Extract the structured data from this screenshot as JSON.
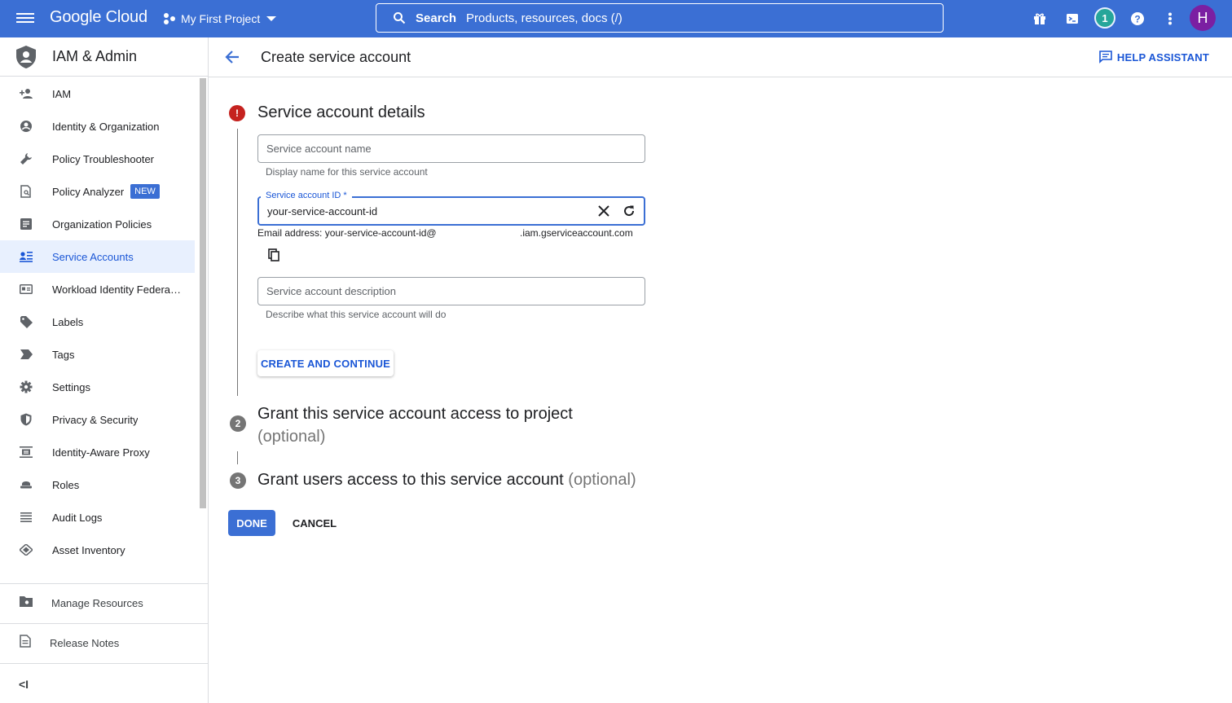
{
  "topbar": {
    "brand": "Google Cloud",
    "project": "My First Project",
    "search_label": "Search",
    "search_placeholder": "Products, resources, docs (/)",
    "notifications": "1",
    "avatar_initial": "H"
  },
  "sidebar": {
    "title": "IAM & Admin",
    "items": [
      {
        "label": "IAM",
        "icon": "person-add-icon"
      },
      {
        "label": "Identity & Organization",
        "icon": "account-circle-icon"
      },
      {
        "label": "Policy Troubleshooter",
        "icon": "wrench-icon"
      },
      {
        "label": "Policy Analyzer",
        "icon": "document-search-icon",
        "badge": "NEW"
      },
      {
        "label": "Organization Policies",
        "icon": "list-document-icon"
      },
      {
        "label": "Service Accounts",
        "icon": "service-account-icon",
        "active": true
      },
      {
        "label": "Workload Identity Federat…",
        "icon": "id-card-icon"
      },
      {
        "label": "Labels",
        "icon": "label-icon"
      },
      {
        "label": "Tags",
        "icon": "tag-icon"
      },
      {
        "label": "Settings",
        "icon": "gear-icon"
      },
      {
        "label": "Privacy & Security",
        "icon": "shield-icon"
      },
      {
        "label": "Identity-Aware Proxy",
        "icon": "proxy-icon"
      },
      {
        "label": "Roles",
        "icon": "roles-icon"
      },
      {
        "label": "Audit Logs",
        "icon": "lines-icon"
      },
      {
        "label": "Asset Inventory",
        "icon": "diamond-icon"
      }
    ],
    "manage_resources": "Manage Resources",
    "release_notes": "Release Notes",
    "collapse": "<I"
  },
  "main": {
    "title": "Create service account",
    "help": "HELP ASSISTANT",
    "step1": {
      "num": "!",
      "title": "Service account details",
      "name_placeholder": "Service account name",
      "name_hint": "Display name for this service account",
      "id_label": "Service account ID *",
      "id_value": "your-service-account-id",
      "email_prefix": "Email address: your-service-account-id@",
      "email_suffix": ".iam.gserviceaccount.com",
      "desc_placeholder": "Service account description",
      "desc_hint": "Describe what this service account will do",
      "create_button": "CREATE AND CONTINUE"
    },
    "step2": {
      "num": "2",
      "title": "Grant this service account access to project",
      "optional": "(optional)"
    },
    "step3": {
      "num": "3",
      "title": "Grant users access to this service account",
      "optional": "(optional)"
    },
    "done": "DONE",
    "cancel": "CANCEL"
  }
}
